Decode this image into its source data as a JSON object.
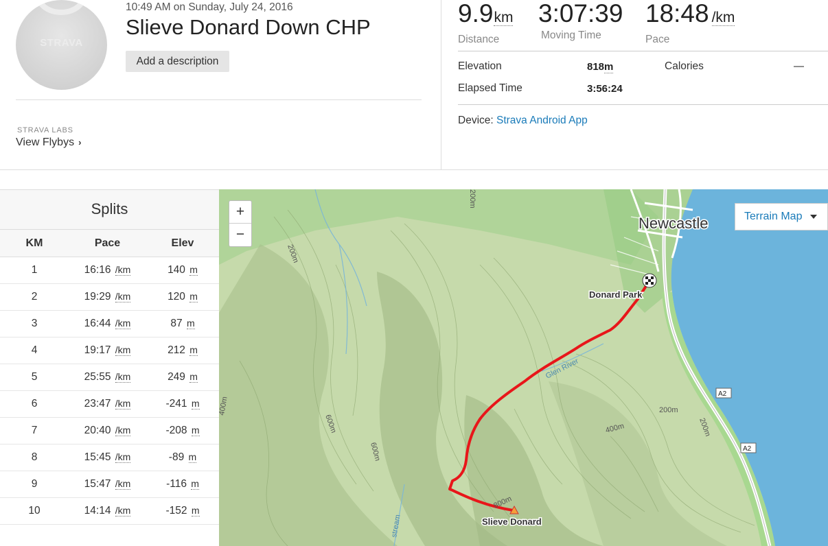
{
  "activity": {
    "datetime": "10:49 AM on Sunday, July 24, 2016",
    "title": "Slieve Donard Down CHP",
    "add_description": "Add a description",
    "avatar_logo": "STRAVA"
  },
  "labs": {
    "label": "STRAVA LABS",
    "link": "View Flybys"
  },
  "stats": {
    "distance": {
      "value": "9.9",
      "unit": "km",
      "label": "Distance"
    },
    "moving_time": {
      "value": "3:07:39",
      "label": "Moving Time"
    },
    "pace": {
      "value": "18:48",
      "unit": "/km",
      "label": "Pace"
    },
    "elevation": {
      "label": "Elevation",
      "value": "818",
      "unit": "m"
    },
    "calories": {
      "label": "Calories",
      "value": "—"
    },
    "elapsed": {
      "label": "Elapsed Time",
      "value": "3:56:24"
    },
    "device_label": "Device:",
    "device_value": "Strava Android App"
  },
  "splits": {
    "title": "Splits",
    "columns": [
      "KM",
      "Pace",
      "Elev"
    ],
    "pace_unit": "/km",
    "elev_unit": "m",
    "rows": [
      {
        "km": "1",
        "pace": "16:16",
        "elev": "140"
      },
      {
        "km": "2",
        "pace": "19:29",
        "elev": "120"
      },
      {
        "km": "3",
        "pace": "16:44",
        "elev": "87"
      },
      {
        "km": "4",
        "pace": "19:17",
        "elev": "212"
      },
      {
        "km": "5",
        "pace": "25:55",
        "elev": "249"
      },
      {
        "km": "6",
        "pace": "23:47",
        "elev": "-241"
      },
      {
        "km": "7",
        "pace": "20:40",
        "elev": "-208"
      },
      {
        "km": "8",
        "pace": "15:45",
        "elev": "-89"
      },
      {
        "km": "9",
        "pace": "15:47",
        "elev": "-116"
      },
      {
        "km": "10",
        "pace": "14:14",
        "elev": "-152"
      }
    ]
  },
  "map": {
    "zoom_in": "+",
    "zoom_out": "−",
    "type_selector": "Terrain Map",
    "labels": {
      "town": "Newcastle",
      "start": "Donard Park",
      "summit": "Slieve Donard",
      "river": "Glen River",
      "stream": "stream",
      "road1": "A2",
      "road2": "A2",
      "c200a": "200m",
      "c200b": "200m",
      "c200c": "200m",
      "c200d": "200m",
      "c400a": "400m",
      "c400b": "400m",
      "c600a": "600m",
      "c600b": "600m",
      "c800": "800m"
    },
    "colors": {
      "route": "#e8161a",
      "sea": "#6cb4dc",
      "land": "#c9dcae"
    }
  }
}
